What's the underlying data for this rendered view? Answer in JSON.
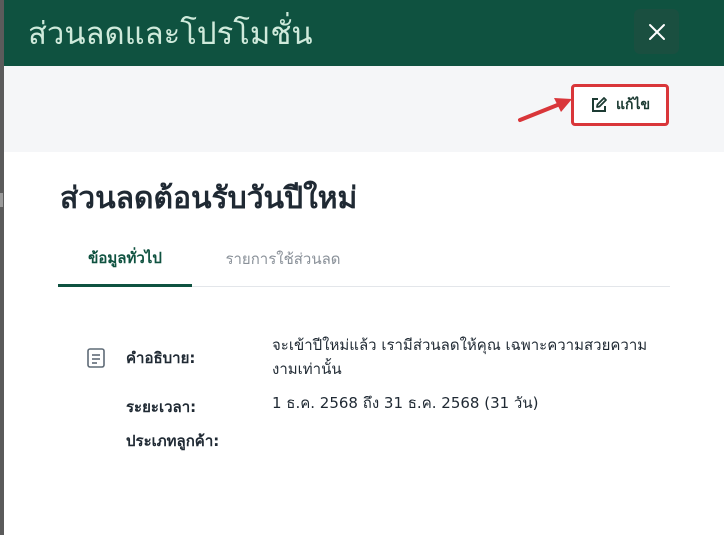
{
  "modal": {
    "title": "ส่วนลดและโปรโมชั่น",
    "close_icon": "close-icon"
  },
  "toolbar": {
    "edit_label": "แก้ไข",
    "edit_icon": "edit-icon",
    "highlight_color": "#d9363a"
  },
  "promotion": {
    "name": "ส่วนลดต้อนรับวันปีใหม่",
    "tabs": [
      {
        "label": "ข้อมูลทั่วไป",
        "active": true
      },
      {
        "label": "รายการใช้ส่วนลด",
        "active": false
      }
    ],
    "details": {
      "description_label": "คำอธิบาย:",
      "description_line1": "จะเข้าปีใหม่แล้ว เรามีส่วนลดให้คุณ เฉพาะความสวยความ",
      "description_line2": "งามเท่านั้น",
      "period_label": "ระยะเวลา:",
      "period_value": "1 ธ.ค. 2568 ถึง 31 ธ.ค. 2568 (31 วัน)",
      "customer_type_label": "ประเภทลูกค้า:"
    }
  },
  "colors": {
    "header_bg": "#0f5240",
    "accent": "#0f5240",
    "annotation_arrow": "#d9363a"
  }
}
